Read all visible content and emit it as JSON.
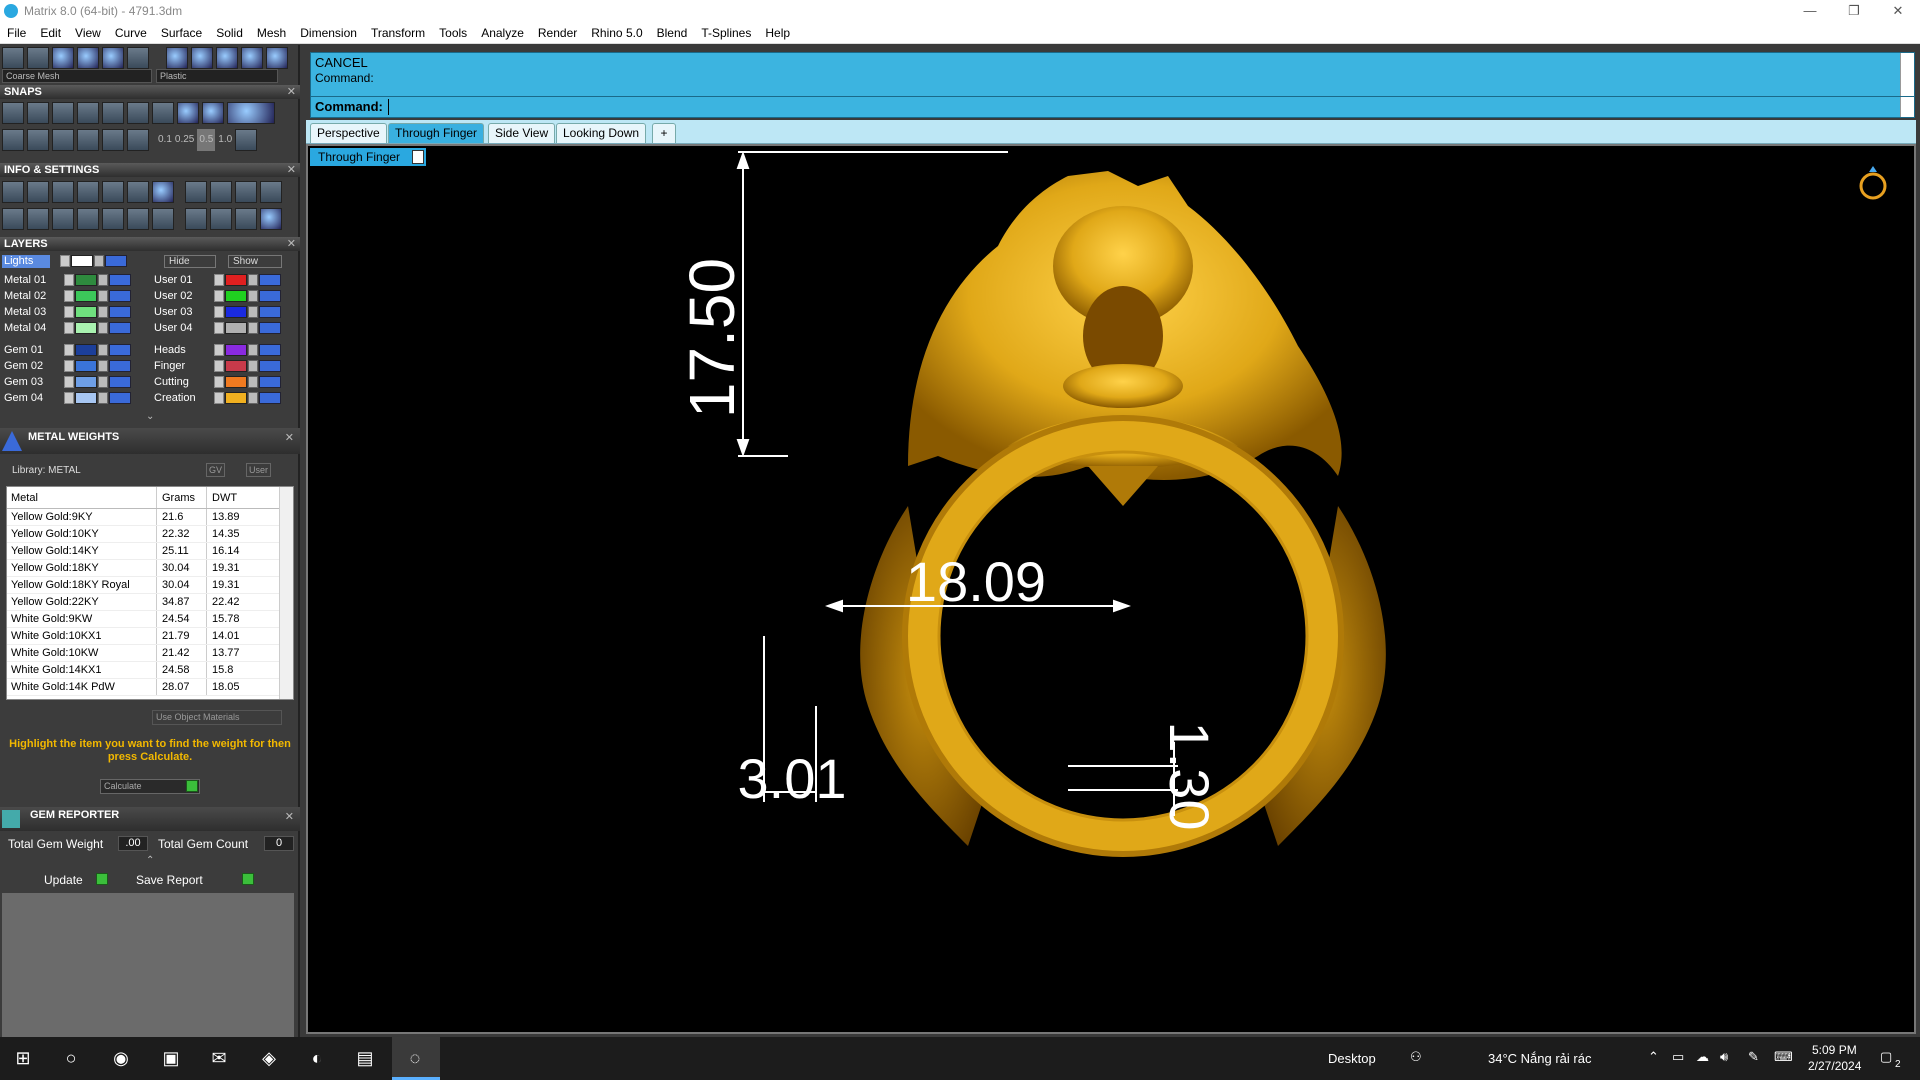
{
  "window": {
    "title": "Matrix 8.0 (64-bit) - 4791.3dm",
    "controls": [
      "—",
      "❐",
      "✕"
    ]
  },
  "menu": [
    "File",
    "Edit",
    "View",
    "Curve",
    "Surface",
    "Solid",
    "Mesh",
    "Dimension",
    "Transform",
    "Tools",
    "Analyze",
    "Render",
    "Rhino 5.0",
    "Blend",
    "T-Splines",
    "Help"
  ],
  "toolbar": {
    "mesh_combo": "Coarse Mesh",
    "material_combo": "Plastic"
  },
  "snaps": {
    "title": "SNAPS",
    "values": [
      "0.1",
      "0.25",
      "0.5",
      "1.0"
    ]
  },
  "info": {
    "title": "INFO & SETTINGS"
  },
  "layers": {
    "title": "LAYERS",
    "lights_label": "Lights",
    "hide_label": "Hide",
    "show_label": "Show",
    "left": [
      {
        "name": "Metal 01",
        "color": "#2e8b3e"
      },
      {
        "name": "Metal 02",
        "color": "#3cc75a"
      },
      {
        "name": "Metal 03",
        "color": "#6fe07e"
      },
      {
        "name": "Metal 04",
        "color": "#a9f2b0"
      },
      {
        "name": "Gem 01",
        "color": "#1c3f9a"
      },
      {
        "name": "Gem 02",
        "color": "#3a74d8"
      },
      {
        "name": "Gem 03",
        "color": "#6e9fe6"
      },
      {
        "name": "Gem 04",
        "color": "#a7c6f2"
      }
    ],
    "right": [
      {
        "name": "User 01",
        "color": "#e02020"
      },
      {
        "name": "User 02",
        "color": "#20d020"
      },
      {
        "name": "User 03",
        "color": "#1a2ae0"
      },
      {
        "name": "User 04",
        "color": "#b0b0b0"
      },
      {
        "name": "Heads",
        "color": "#8a2ae0"
      },
      {
        "name": "Finger",
        "color": "#c83a4a"
      },
      {
        "name": "Cutting",
        "color": "#f07a20"
      },
      {
        "name": "Creation",
        "color": "#f0b020"
      }
    ]
  },
  "metal_weights": {
    "title": "METAL WEIGHTS",
    "library": "Library: METAL",
    "gv_label": "GV",
    "user_label": "User",
    "columns": [
      "Metal",
      "Grams",
      "DWT"
    ],
    "rows": [
      [
        "Yellow Gold:9KY",
        "21.6",
        "13.89"
      ],
      [
        "Yellow Gold:10KY",
        "22.32",
        "14.35"
      ],
      [
        "Yellow Gold:14KY",
        "25.11",
        "16.14"
      ],
      [
        "Yellow Gold:18KY",
        "30.04",
        "19.31"
      ],
      [
        "Yellow Gold:18KY Royal",
        "30.04",
        "19.31"
      ],
      [
        "Yellow Gold:22KY",
        "34.87",
        "22.42"
      ],
      [
        "White Gold:9KW",
        "24.54",
        "15.78"
      ],
      [
        "White Gold:10KX1",
        "21.79",
        "14.01"
      ],
      [
        "White Gold:10KW",
        "21.42",
        "13.77"
      ],
      [
        "White Gold:14KX1",
        "24.58",
        "15.8"
      ],
      [
        "White Gold:14K PdW",
        "28.07",
        "18.05"
      ]
    ],
    "use_object_materials": "Use Object Materials",
    "hint": "Highlight the item you want to find the weight for then press Calculate.",
    "calculate": "Calculate"
  },
  "gem_reporter": {
    "title": "GEM REPORTER",
    "total_weight_label": "Total Gem Weight",
    "total_weight_value": ".00",
    "total_count_label": "Total Gem Count",
    "total_count_value": "0",
    "update": "Update",
    "save_report": "Save Report"
  },
  "command": {
    "line1": "CANCEL",
    "line2": "Command:",
    "prompt": "Command:"
  },
  "tabs": [
    "Perspective",
    "Through Finger",
    "Side View",
    "Looking Down"
  ],
  "active_tab": "Through Finger",
  "viewport": {
    "label": "Through Finger",
    "dim_height": "17.50",
    "dim_inner": "18.09",
    "dim_band": "3.01",
    "dim_thickness": "1.30",
    "colors": {
      "background": "#000000",
      "gold": "#e0a818",
      "dim": "#ffffff"
    }
  },
  "taskbar": {
    "desktop": "Desktop",
    "weather": "34°C  Nắng rải rác",
    "time": "5:09 PM",
    "date": "2/27/2024",
    "notif_count": "2"
  }
}
